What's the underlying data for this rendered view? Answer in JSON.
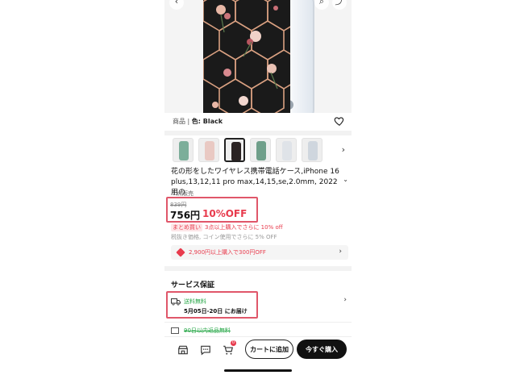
{
  "product": {
    "variant_prefix": "商品",
    "variant_label": "色: Black",
    "title": "花の形をしたワイヤレス携帯電話ケース,iPhone 16 plus,13,12,11 pro max,14,15,se,2.0mm, 2022 用の",
    "sold_count": "１点販売",
    "original_price": "839円",
    "price": "756円",
    "discount": "10%OFF"
  },
  "promo": {
    "bundle_tag": "まとめ買い",
    "bundle_text": "3点以上購入でさらに 10% off",
    "coin_text": "税抜き価格, コイン使用でさらに 5% OFF",
    "coupon_text": "2,900円以上購入で300円OFF"
  },
  "service": {
    "title": "サービス保証",
    "shipping_label": "送料無料",
    "delivery_date": "5月05日-20日 にお届け",
    "returns_label": "90日以内返品無料"
  },
  "bottom_bar": {
    "cart_badge": "0",
    "add_to_cart": "カートに追加",
    "buy_now": "今すぐ購入"
  },
  "colors": {
    "accent_red": "#e83b4d",
    "highlight_box": "#e0576a",
    "free_green": "#2aa84a"
  }
}
